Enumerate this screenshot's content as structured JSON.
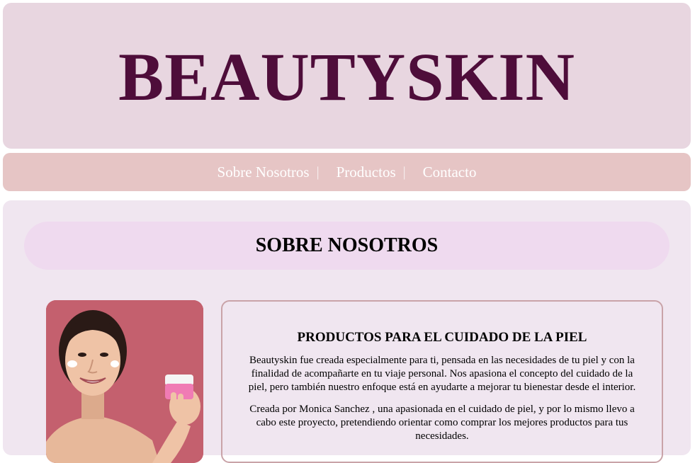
{
  "header": {
    "brand": "BEAUTYSKIN"
  },
  "nav": {
    "items": [
      {
        "label": "Sobre Nosotros"
      },
      {
        "label": "Productos"
      },
      {
        "label": "Contacto"
      }
    ],
    "separator": "|"
  },
  "main": {
    "section_title": "SOBRE NOSOTROS",
    "card": {
      "heading": "PRODUCTOS PARA EL CUIDADO DE LA PIEL",
      "paragraph1": "Beautyskin fue creada especialmente para ti, pensada en las necesidades de tu piel y con la finalidad de acompañarte en tu viaje personal. Nos apasiona el concepto del cuidado de la piel, pero también nuestro enfoque está en ayudarte a mejorar tu bienestar desde el interior.",
      "paragraph2": "Creada por Monica Sanchez , una apasionada en el cuidado de piel, y por lo mismo llevo a cabo este proyecto, pretendiendo orientar como comprar los mejores productos para tus necesidades."
    }
  },
  "colors": {
    "brand": "#4e0d3a",
    "header_bg": "#e8d6e0",
    "nav_bg": "#e6c5c5",
    "main_bg": "#f0e6f0",
    "title_bg": "#efdaef",
    "photo_bg": "#c4606e"
  }
}
